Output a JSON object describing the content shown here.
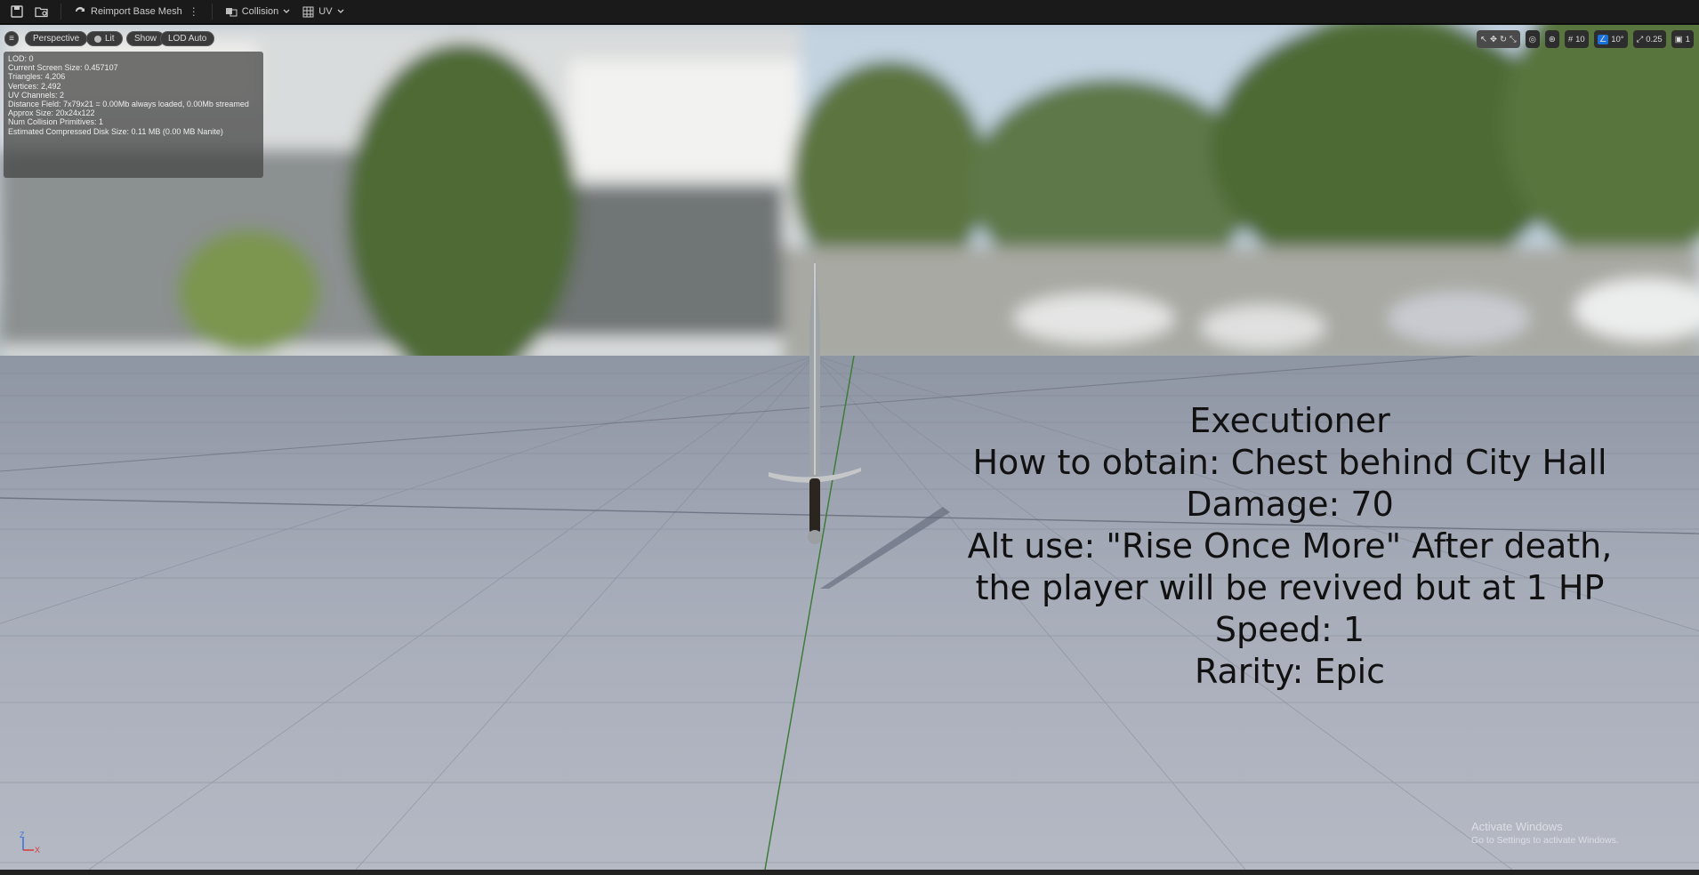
{
  "toolbar": {
    "reimport_label": "Reimport Base Mesh",
    "collision_label": "Collision",
    "uv_label": "UV"
  },
  "viewport": {
    "perspective_label": "Perspective",
    "lit_label": "Lit",
    "show_label": "Show",
    "lod_label": "LOD Auto",
    "grid_snap": "10",
    "rotation_snap": "10°",
    "scale_snap": "0.25",
    "camera_speed": "1"
  },
  "stats": [
    "LOD: 0",
    "Current Screen Size: 0.457107",
    "Triangles: 4,206",
    "Vertices: 2,492",
    "UV Channels: 2",
    "Distance Field: 7x79x21 = 0.00Mb always loaded, 0.00Mb streamed",
    "Approx Size: 20x24x122",
    "Num Collision Primitives: 1",
    "Estimated Compressed Disk Size: 0.11 MB (0.00 MB Nanite)"
  ],
  "item_info": {
    "name": "Executioner",
    "obtain": "How to obtain: Chest behind City Hall",
    "damage": "Damage: 70",
    "alt_use_1": "Alt use: \"Rise Once More\" After death,",
    "alt_use_2": "the player will be revived but at 1 HP",
    "speed": "Speed: 1",
    "rarity": "Rarity: Epic"
  },
  "watermark": {
    "title": "Activate Windows",
    "subtitle": "Go to Settings to activate Windows."
  },
  "axis": {
    "z": "Z",
    "x": "X"
  }
}
